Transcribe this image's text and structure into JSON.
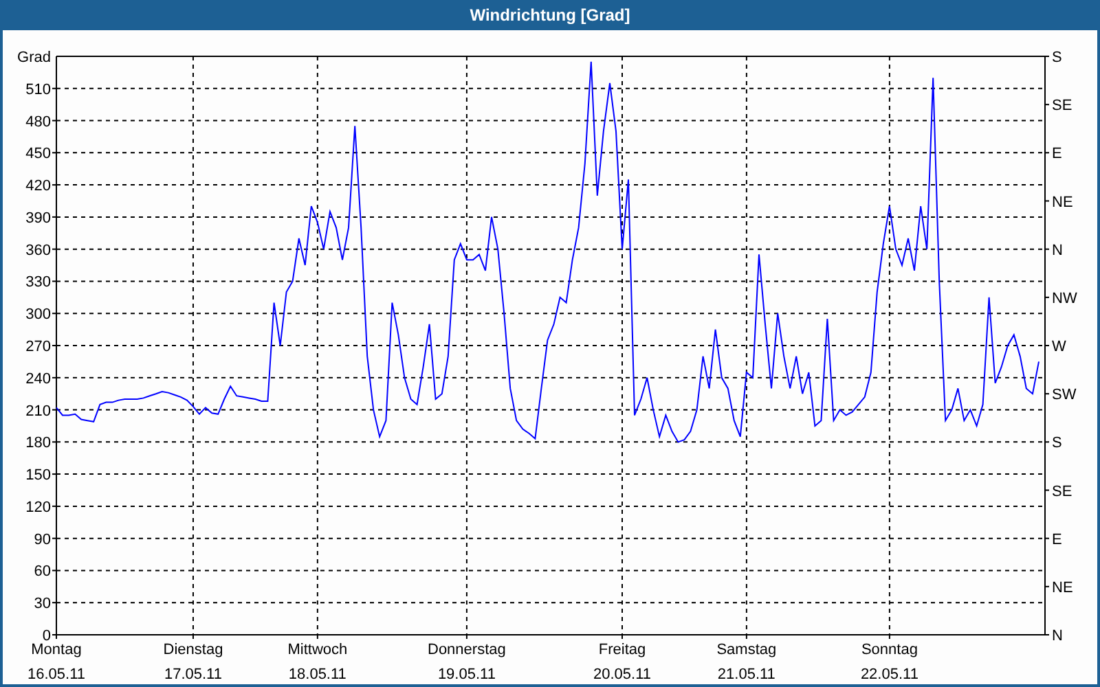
{
  "window": {
    "title": "Windrichtung [Grad]"
  },
  "chart": {
    "chart_data": {
      "type": "line",
      "grid": true,
      "ylabel": "Grad",
      "ylim": [
        0,
        540
      ],
      "yticks": [
        0,
        30,
        60,
        90,
        120,
        150,
        180,
        210,
        240,
        270,
        300,
        330,
        360,
        390,
        420,
        450,
        480,
        510
      ],
      "categories": [
        "Montag",
        null,
        null,
        null,
        null,
        null,
        null,
        null,
        null,
        null,
        null,
        null,
        null,
        null,
        null,
        null,
        null,
        null,
        null,
        null,
        null,
        null,
        "Dienstag",
        null,
        null,
        null,
        null,
        null,
        null,
        null,
        null,
        null,
        null,
        null,
        null,
        null,
        null,
        null,
        null,
        null,
        null,
        null,
        "Mittwoch",
        null,
        null,
        null,
        null,
        null,
        null,
        null,
        null,
        null,
        null,
        null,
        null,
        null,
        null,
        null,
        null,
        null,
        null,
        null,
        null,
        null,
        null,
        null,
        "Donnerstag",
        null,
        null,
        null,
        null,
        null,
        null,
        null,
        null,
        null,
        null,
        null,
        null,
        null,
        null,
        null,
        null,
        null,
        null,
        null,
        null,
        null,
        null,
        null,
        null,
        "Freitag",
        null,
        null,
        null,
        null,
        null,
        null,
        null,
        null,
        null,
        null,
        null,
        null,
        null,
        null,
        null,
        null,
        null,
        null,
        null,
        "Samstag",
        null,
        null,
        null,
        null,
        null,
        null,
        null,
        null,
        null,
        null,
        null,
        null,
        null,
        null,
        null,
        null,
        null,
        null,
        null,
        null,
        null,
        null,
        "Sonntag",
        null,
        null,
        null,
        null,
        null,
        null,
        null,
        null,
        null,
        null,
        null,
        null,
        null,
        null,
        null,
        null,
        null,
        null,
        null,
        null,
        null,
        null,
        null,
        null
      ],
      "series": [
        {
          "color": "#0000ff",
          "values": [
            212,
            205,
            205,
            206,
            201,
            200,
            199,
            215,
            217,
            217,
            219,
            220,
            220,
            220,
            221,
            223,
            225,
            227,
            226,
            224,
            222,
            219,
            213,
            206,
            212,
            207,
            206,
            220,
            232,
            223,
            222,
            221,
            220,
            218,
            218,
            310,
            270,
            320,
            330,
            370,
            345,
            400,
            385,
            360,
            395,
            380,
            350,
            380,
            475,
            380,
            260,
            210,
            185,
            200,
            310,
            280,
            240,
            220,
            215,
            250,
            290,
            220,
            225,
            260,
            350,
            365,
            350,
            350,
            355,
            340,
            390,
            360,
            300,
            230,
            200,
            192,
            188,
            183,
            230,
            275,
            290,
            315,
            310,
            350,
            380,
            440,
            535,
            410,
            470,
            515,
            470,
            360,
            425,
            205,
            220,
            240,
            210,
            185,
            205,
            190,
            180,
            182,
            190,
            210,
            260,
            230,
            285,
            240,
            230,
            200,
            185,
            245,
            240,
            355,
            290,
            230,
            300,
            260,
            230,
            260,
            225,
            245,
            195,
            200,
            295,
            200,
            210,
            205,
            208,
            215,
            222,
            245,
            320,
            365,
            400,
            360,
            345,
            370,
            340,
            400,
            360,
            520,
            330,
            200,
            210,
            230,
            200,
            210,
            195,
            215,
            315,
            235,
            250,
            270,
            280,
            260,
            230,
            225,
            255
          ]
        }
      ]
    },
    "x_dates": [
      "16.05.11",
      "17.05.11",
      "18.05.11",
      "19.05.11",
      "20.05.11",
      "21.05.11",
      "22.05.11"
    ],
    "right_axis_labels": [
      "S",
      "SE",
      "E",
      "NE",
      "N",
      "NW",
      "W",
      "SW",
      "S",
      "SE",
      "E",
      "NE",
      "N"
    ]
  }
}
